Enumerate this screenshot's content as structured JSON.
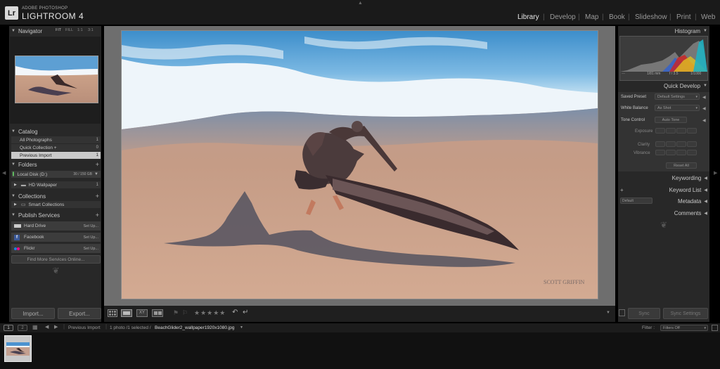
{
  "app": {
    "brand_small": "ADOBE PHOTOSHOP",
    "brand_big": "LIGHTROOM 4",
    "logo": "Lr"
  },
  "modules": [
    "Library",
    "Develop",
    "Map",
    "Book",
    "Slideshow",
    "Print",
    "Web"
  ],
  "left": {
    "navigator": {
      "title": "Navigator",
      "zoom_options": [
        "FIT",
        "FILL",
        "1:1",
        "3:1"
      ]
    },
    "catalog": {
      "title": "Catalog",
      "items": [
        {
          "label": "All Photographs",
          "count": "1"
        },
        {
          "label": "Quick Collection +",
          "count": "0"
        },
        {
          "label": "Previous Import",
          "count": "1"
        }
      ]
    },
    "folders": {
      "title": "Folders",
      "disk": "Local Disk (D:)",
      "disk_space": "30 / 150 GB",
      "folder": "HD Wallpaper",
      "folder_count": "1"
    },
    "collections": {
      "title": "Collections",
      "item": "Smart Collections"
    },
    "publish": {
      "title": "Publish Services",
      "services": [
        {
          "name": "Hard Drive",
          "action": "Set Up..."
        },
        {
          "name": "Facebook",
          "action": "Set Up..."
        },
        {
          "name": "Flickr",
          "action": "Set Up..."
        }
      ],
      "find_more": "Find More Services Online..."
    },
    "import_label": "Import...",
    "export_label": "Export..."
  },
  "right": {
    "histogram": {
      "title": "Histogram",
      "info": [
        "1/81 mm",
        "f / 3.5",
        "1/1000"
      ]
    },
    "quick_develop": {
      "title": "Quick Develop",
      "saved_preset_label": "Saved Preset",
      "saved_preset_value": "Default Settings",
      "white_balance_label": "White Balance",
      "white_balance_value": "As Shot",
      "tone_control_label": "Tone Control",
      "auto_tone": "Auto Tone",
      "exposure": "Exposure",
      "clarity": "Clarity",
      "vibrance": "Vibrance",
      "reset_all": "Reset All"
    },
    "keywording": "Keywording",
    "keyword_list": "Keyword List",
    "metadata": "Metadata",
    "metadata_preset": "Default",
    "comments": "Comments",
    "sync_label": "Sync",
    "sync_settings_label": "Sync Settings"
  },
  "toolbar": {
    "rating": "★★★★★"
  },
  "filmstrip": {
    "pages": [
      "1",
      "2"
    ],
    "source": "Previous Import",
    "selection_info": "1 photo /1 selected /",
    "filename": "BeachGlider2_wallpaper1920x1080.jpg",
    "filter_label": "Filter :",
    "filter_value": "Filters Off"
  },
  "photo": {
    "watermark": "SCOTT GRIFFIN"
  },
  "colors": {
    "accent": "#e8e8e8",
    "panel": "#282828",
    "background": "#6e6e6e"
  }
}
